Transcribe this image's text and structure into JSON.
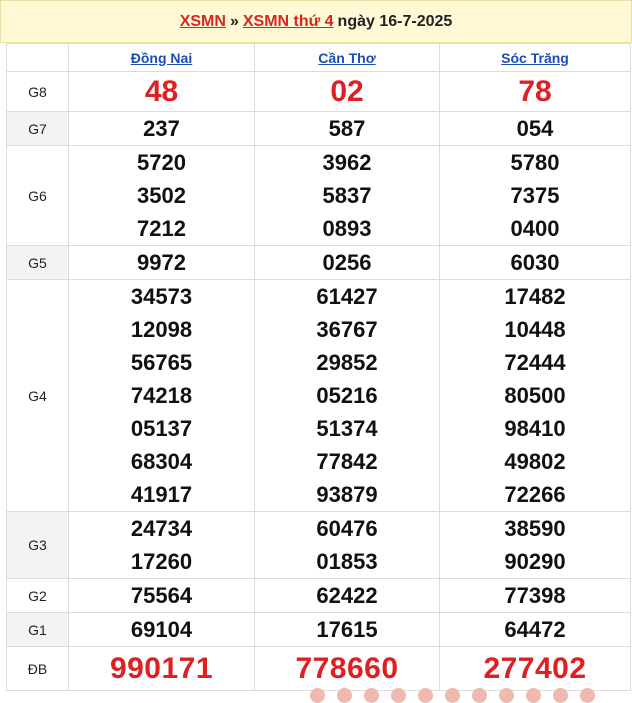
{
  "header": {
    "link1": "XSMN",
    "separator": "»",
    "link2": "XSMN thứ 4",
    "date_text": "ngày 16-7-2025"
  },
  "provinces": [
    "Đồng Nai",
    "Cần Thơ",
    "Sóc Trăng"
  ],
  "prizes": {
    "G8": {
      "label": "G8",
      "values": [
        [
          "48"
        ],
        [
          "02"
        ],
        [
          "78"
        ]
      ]
    },
    "G7": {
      "label": "G7",
      "values": [
        [
          "237"
        ],
        [
          "587"
        ],
        [
          "054"
        ]
      ]
    },
    "G6": {
      "label": "G6",
      "values": [
        [
          "5720",
          "3502",
          "7212"
        ],
        [
          "3962",
          "5837",
          "0893"
        ],
        [
          "5780",
          "7375",
          "0400"
        ]
      ]
    },
    "G5": {
      "label": "G5",
      "values": [
        [
          "9972"
        ],
        [
          "0256"
        ],
        [
          "6030"
        ]
      ]
    },
    "G4": {
      "label": "G4",
      "values": [
        [
          "34573",
          "12098",
          "56765",
          "74218",
          "05137",
          "68304",
          "41917"
        ],
        [
          "61427",
          "36767",
          "29852",
          "05216",
          "51374",
          "77842",
          "93879"
        ],
        [
          "17482",
          "10448",
          "72444",
          "80500",
          "98410",
          "49802",
          "72266"
        ]
      ]
    },
    "G3": {
      "label": "G3",
      "values": [
        [
          "24734",
          "17260"
        ],
        [
          "60476",
          "01853"
        ],
        [
          "38590",
          "90290"
        ]
      ]
    },
    "G2": {
      "label": "G2",
      "values": [
        [
          "75564"
        ],
        [
          "62422"
        ],
        [
          "77398"
        ]
      ]
    },
    "G1": {
      "label": "G1",
      "values": [
        [
          "69104"
        ],
        [
          "17615"
        ],
        [
          "64472"
        ]
      ]
    },
    "DB": {
      "label": "ĐB",
      "values": [
        [
          "990171"
        ],
        [
          "778660"
        ],
        [
          "277402"
        ]
      ]
    }
  }
}
